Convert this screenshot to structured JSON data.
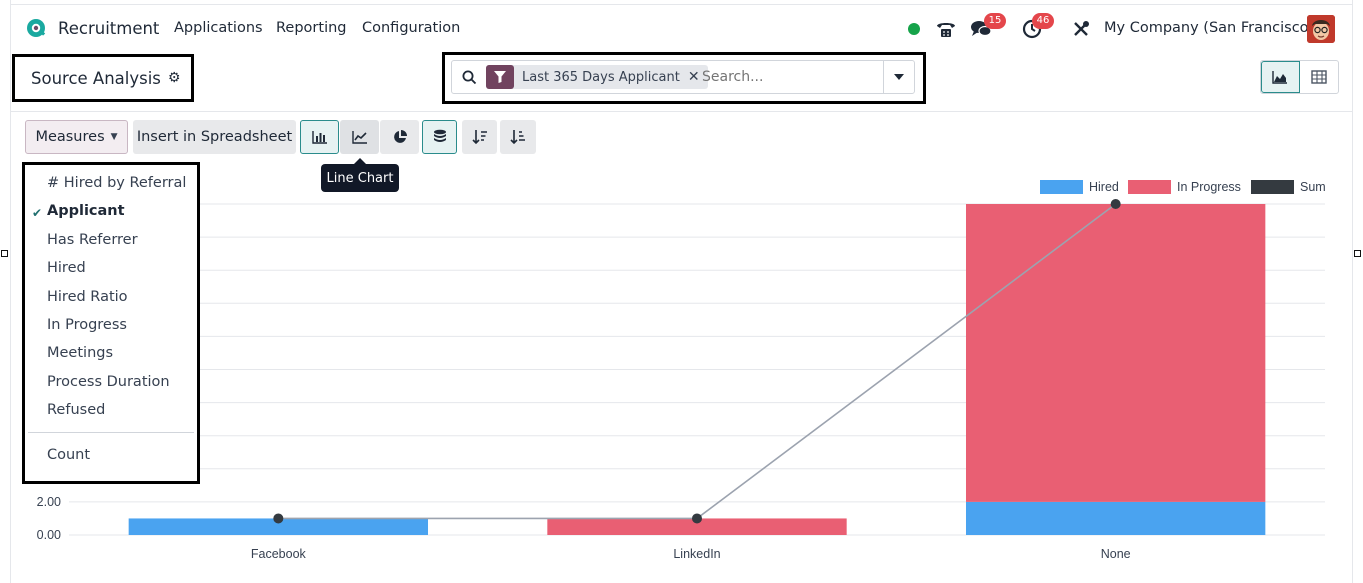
{
  "nav": {
    "app_name": "Recruitment",
    "menus": [
      "Applications",
      "Reporting",
      "Configuration"
    ],
    "chat_badge": "15",
    "activity_badge": "46",
    "company": "My Company (San Francisco)"
  },
  "control_panel": {
    "title": "Source Analysis",
    "search": {
      "facet_label": "Last 365 Days Applicant",
      "placeholder": "Search..."
    }
  },
  "toolbar": {
    "measures_label": "Measures",
    "insert_label": "Insert in Spreadsheet",
    "tooltip": "Line Chart"
  },
  "measures_menu": {
    "items": [
      {
        "label": "# Hired by Referral",
        "checked": false
      },
      {
        "label": "Applicant",
        "checked": true
      },
      {
        "label": "Has Referrer",
        "checked": false
      },
      {
        "label": "Hired",
        "checked": false
      },
      {
        "label": "Hired Ratio",
        "checked": false
      },
      {
        "label": "In Progress",
        "checked": false
      },
      {
        "label": "Meetings",
        "checked": false
      },
      {
        "label": "Process Duration",
        "checked": false
      },
      {
        "label": "Refused",
        "checked": false
      }
    ],
    "count_label": "Count",
    "check_glyph": "✔"
  },
  "colors": {
    "hired": "#4aa3f0",
    "in_progress": "#e95f73",
    "sum": "#343a40",
    "accent": "#71435f"
  },
  "chart_data": {
    "type": "bar",
    "stacked": true,
    "categories": [
      "Facebook",
      "LinkedIn",
      "None"
    ],
    "series": [
      {
        "name": "Hired",
        "values": [
          1,
          0,
          2
        ]
      },
      {
        "name": "In Progress",
        "values": [
          0,
          1,
          18
        ]
      },
      {
        "name": "Sum",
        "type": "line",
        "values": [
          1,
          1,
          20
        ]
      }
    ],
    "yticks": [
      "0.00",
      "2.00"
    ],
    "ylim": [
      0,
      20
    ],
    "grid": true,
    "legend": "top-right"
  }
}
